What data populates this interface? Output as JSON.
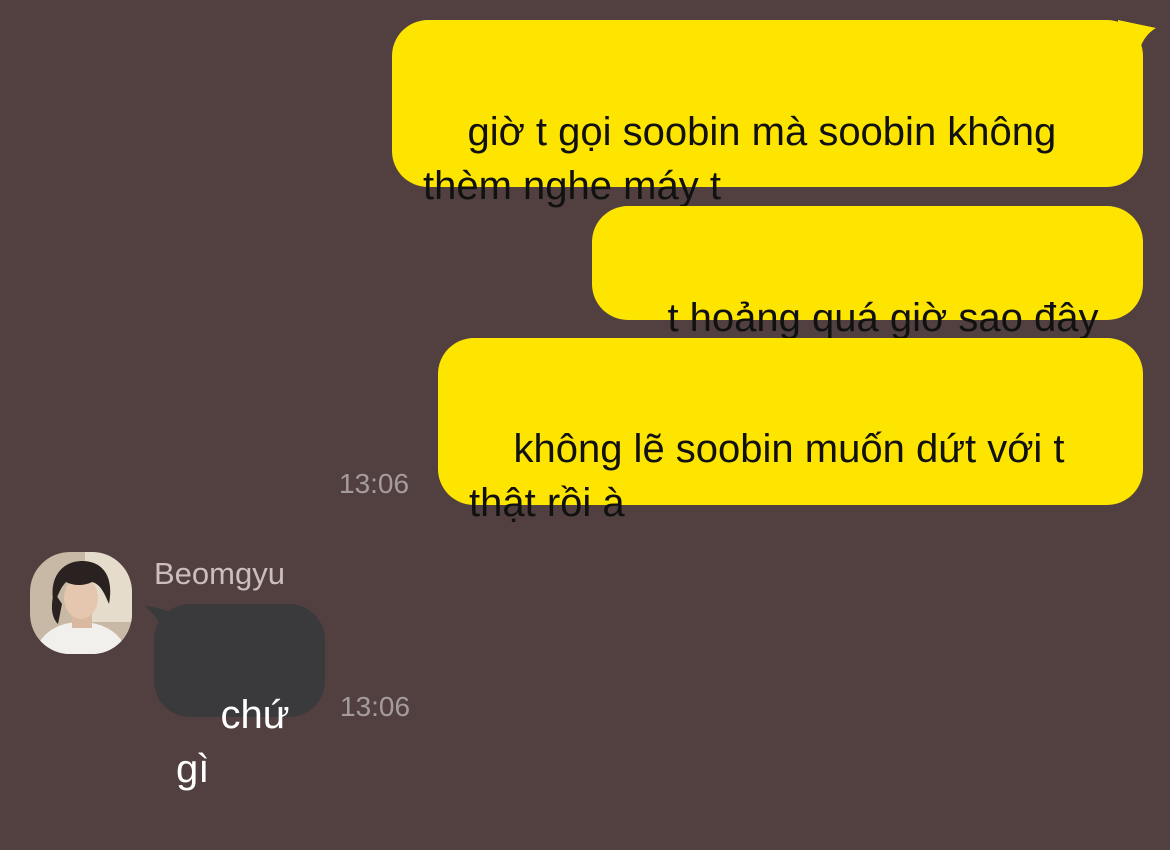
{
  "theme": {
    "background": "#524041",
    "outgoing_bubble": "#fee500",
    "incoming_bubble": "#3a3a3c",
    "incoming_text": "#ffffff",
    "outgoing_text": "#111111"
  },
  "messages_outgoing": [
    {
      "text": "giờ t gọi soobin mà soobin không\nthèm nghe máy t"
    },
    {
      "text": "t hoảng quá giờ sao đây"
    },
    {
      "text": "không lẽ soobin muốn dứt với t\nthật rồi à"
    }
  ],
  "outgoing_time": "13:06",
  "incoming": {
    "sender": "Beomgyu",
    "avatar_icon": "profile-photo",
    "text": "chứ gì",
    "time": "13:06"
  }
}
